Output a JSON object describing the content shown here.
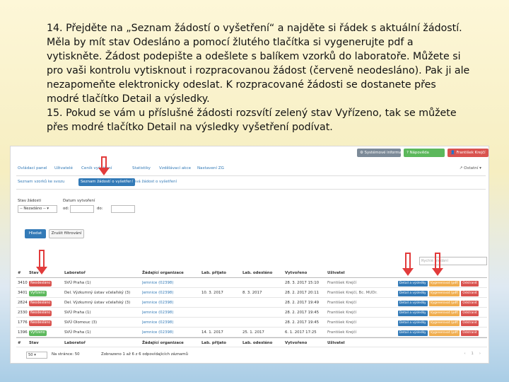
{
  "instructions": {
    "p14": "14. Přejděte na „Seznam žádostí o vyšetření“ a najděte si řádek s aktuální žádostí. Měla by mít stav Odesláno a pomocí žlutého tlačítka si vygenerujte pdf a vytiskněte. Žádost podepište a odešlete s balíkem vzorků do laboratoře. Můžete si pro vaši kontrolu vytisknout i rozpracovanou žádost (červeně neodesláno). Pak ji ale nezapomeňte elektronicky odeslat. K rozpracované žádosti se dostanete přes modré tlačítko Detail a výsledky.",
    "p15": "15. Pokud se vám u příslušné žádosti rozsvítí zelený stav Vyřízeno, tak se můžete přes modré tlačítko Detail na výsledky vyšetření podívat."
  },
  "topbar": {
    "system_info": "Systémové informace",
    "help": "Nápověda",
    "user": "František Krejčí"
  },
  "nav": {
    "items": [
      "Ovládací panel",
      "Uživatelé",
      "Ceník vyšetření",
      "",
      "Statistiky",
      "Vzdělávací akce",
      "Nastavení ZG"
    ],
    "right": "Ostatní"
  },
  "subnav": {
    "items": [
      "Seznam vzorků ke svozu",
      "Seznam žádostí o vyšetření",
      "Nová žádost o vyšetření"
    ]
  },
  "filter": {
    "state_label": "Stav žádosti",
    "state_value": "-- Nezadáno --",
    "date_label": "Datum vytvoření",
    "from_label": "od:",
    "to_label": "do:",
    "find_button": "Hledat",
    "reset_button": "Zrušit filtrování",
    "search_placeholder": "Rychlé hledání"
  },
  "table": {
    "headers": [
      "#",
      "Stav",
      "Laboratoř",
      "Žádající organizace",
      "Lab. přijato",
      "Lab. odesláno",
      "Vytvořeno",
      "Uživatel",
      ""
    ],
    "rows": [
      {
        "id": "3410",
        "status": "Neodesláno",
        "status_color": "red",
        "lab": "SVÚ Praha (1)",
        "org": "Jemnice (02398)",
        "received": "",
        "sent": "",
        "created": "28. 3. 2017 15:10",
        "user": "František Krejčí"
      },
      {
        "id": "3401",
        "status": "Vyřízeno",
        "status_color": "green",
        "lab": "Del. Výzkumný ústav včelařský (3)",
        "org": "Jemnice (02398)",
        "received": "10. 3. 2017",
        "sent": "8. 3. 2017",
        "created": "28. 2. 2017 20:11",
        "user": "František Krejčí, Bc. MUDr."
      },
      {
        "id": "2824",
        "status": "Neodesláno",
        "status_color": "red",
        "lab": "Del. Výzkumný ústav včelařský (3)",
        "org": "Jemnice (02398)",
        "received": "",
        "sent": "",
        "created": "28. 2. 2017 19:49",
        "user": "František Krejčí"
      },
      {
        "id": "2330",
        "status": "Neodesláno",
        "status_color": "red",
        "lab": "SVÚ Praha (1)",
        "org": "Jemnice (02398)",
        "received": "",
        "sent": "",
        "created": "28. 2. 2017 19:45",
        "user": "František Krejčí"
      },
      {
        "id": "1776",
        "status": "Neodesláno",
        "status_color": "red",
        "lab": "SVÚ Olomouc (3)",
        "org": "Jemnice (02398)",
        "received": "",
        "sent": "",
        "created": "28. 2. 2017 19:45",
        "user": "František Krejčí"
      },
      {
        "id": "1396",
        "status": "Vyřízeno",
        "status_color": "green",
        "lab": "SVÚ Praha (1)",
        "org": "Jemnice (02398)",
        "received": "14. 1. 2017",
        "sent": "25. 1. 2017",
        "created": "6. 1. 2017 17:25",
        "user": "František Krejčí"
      }
    ],
    "row_buttons": {
      "detail": "Detail a výsledky",
      "pdf": "Vygenerovat (pdf)",
      "delete": "Odstranit"
    }
  },
  "pager": {
    "page_size": "50",
    "page_label": "Na stránce: 50",
    "summary": "Zobrazeno 1 až 6 z 6 odpovídajících záznamů"
  },
  "colors": {
    "accent_blue": "#337ab7",
    "status_red": "#d9534f",
    "status_green": "#5cb85c",
    "pdf_yellow": "#f0ad4e",
    "annotation_arrow": "#e23b3b"
  }
}
